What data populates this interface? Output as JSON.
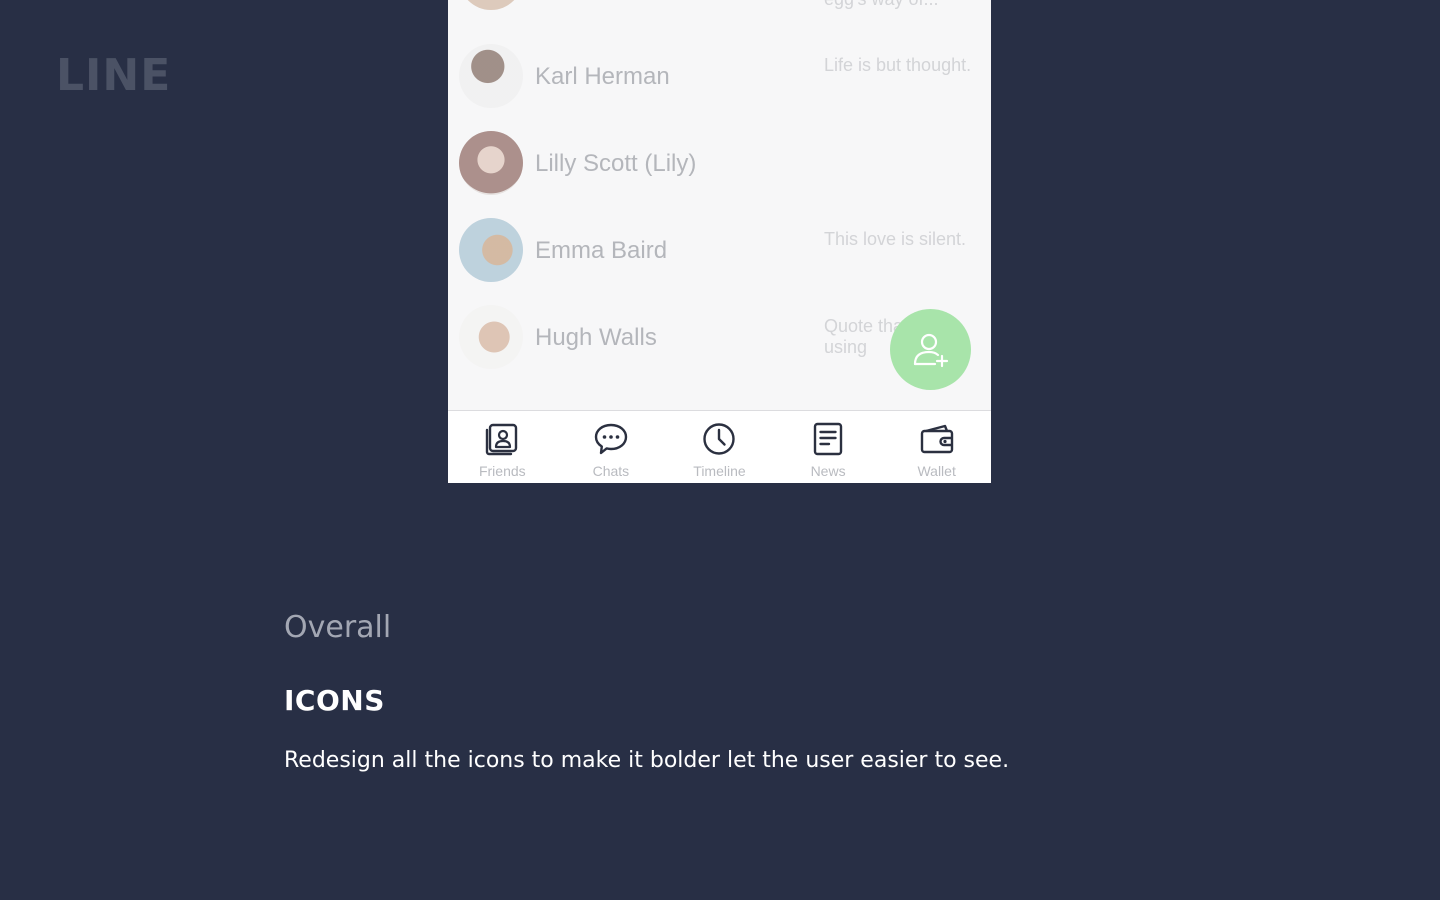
{
  "brand": "LINE",
  "friends": [
    {
      "name": "",
      "status": "egg's way of...",
      "avatar_color": "#c9a58a"
    },
    {
      "name": "Karl Herman",
      "status": "Life is but thought.",
      "avatar_color": "#6b4a3a"
    },
    {
      "name": "Lilly Scott (Lily)",
      "status": "",
      "avatar_color": "#8a5a4a"
    },
    {
      "name": "Emma Baird",
      "status": "This love is silent.",
      "avatar_color": "#8fa7b8"
    },
    {
      "name": "Hugh Walls",
      "status": "Quote that user using",
      "avatar_color": "#b8b1a8"
    }
  ],
  "fab": {
    "icon": "add-friend-icon",
    "color": "#a8e4aa"
  },
  "tabbar": {
    "tabs": [
      {
        "label": "Friends",
        "icon": "friends-icon"
      },
      {
        "label": "Chats",
        "icon": "chats-icon"
      },
      {
        "label": "Timeline",
        "icon": "timeline-icon"
      },
      {
        "label": "News",
        "icon": "news-icon"
      },
      {
        "label": "Wallet",
        "icon": "wallet-icon"
      }
    ]
  },
  "section": {
    "subtitle": "Overall",
    "title": "ICONS",
    "description": "Redesign all the icons to make it bolder let the user easier to see."
  },
  "colors": {
    "background": "#282f45",
    "icon": "#2b3040",
    "fab": "#a8e4aa"
  }
}
